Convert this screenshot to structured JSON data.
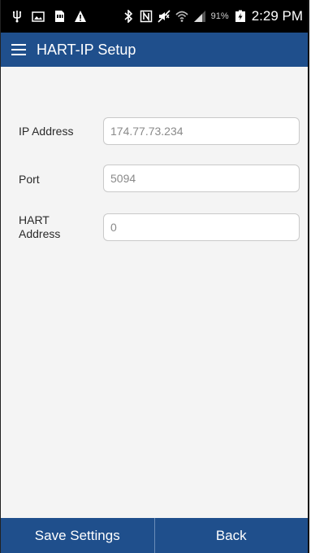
{
  "status_bar": {
    "icons_left": [
      "usb-icon",
      "image-icon",
      "sd-card-icon",
      "warning-icon"
    ],
    "icons_right": [
      "bluetooth-icon",
      "nfc-icon",
      "mute-icon",
      "wifi-icon",
      "signal-icon"
    ],
    "battery_percent": "91%",
    "time": "2:29 PM"
  },
  "app_bar": {
    "title": "HART-IP Setup",
    "menu_icon": "hamburger-menu-icon"
  },
  "form": {
    "ip_address": {
      "label": "IP Address",
      "value": "174.77.73.234"
    },
    "port": {
      "label": "Port",
      "value": "5094"
    },
    "hart_address": {
      "label": "HART\nAddress",
      "value": "0"
    }
  },
  "buttons": {
    "save_label": "Save Settings",
    "back_label": "Back"
  },
  "colors": {
    "primary": "#1f4f8c",
    "status_bar": "#000000",
    "background": "#f4f4f4"
  }
}
